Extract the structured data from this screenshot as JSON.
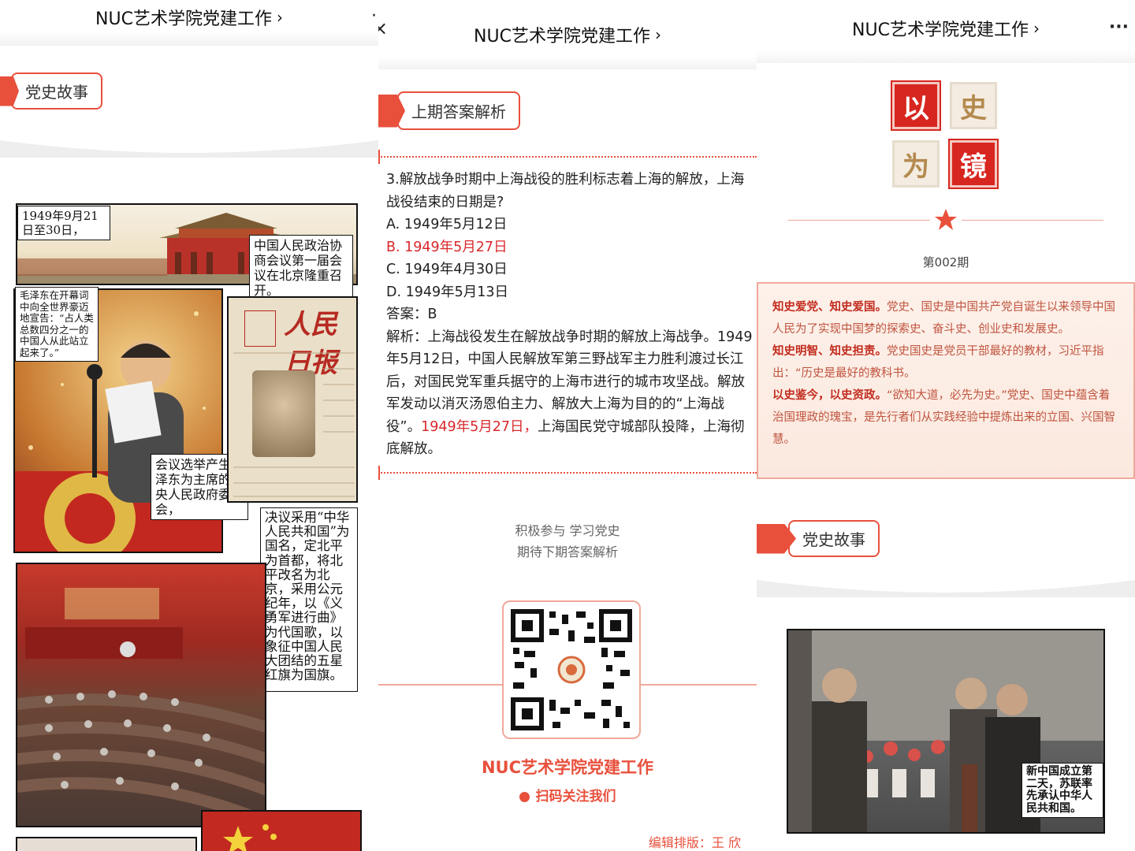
{
  "p1": {
    "title": "NUC艺术学院党建工作",
    "dots_icon": "·",
    "section_tag": "党史故事",
    "comic": {
      "box1": "1949年9月21日至30日，",
      "box2": "中国人民政治协商会议第一届会议在北京隆重召开。",
      "box3": "毛泽东在开幕词中向全世界豪迈地宣告：“占人类总数四分之一的中国人从此站立起来了。”",
      "newspaper": "人民日报",
      "box4": "会议选举产生毛泽东为主席的中央人民政府委员会，",
      "box5": "决议采用“中华人民共和国”为国名，定北平为首都，将北平改名为北京，采用公元纪年，以《义勇军进行曲》为代国歌，以象征中国人民大团结的五星红旗为国旗。"
    }
  },
  "p2": {
    "title": "NUC艺术学院党建工作",
    "close_icon": "×",
    "section_tag": "上期答案解析",
    "question": "3.解放战争时期中上海战役的胜利标志着上海的解放，上海战役结束的日期是?",
    "options": [
      "A. 1949年5月12日",
      "B. 1949年5月27日",
      "C. 1949年4月30日",
      "D. 1949年5月13日"
    ],
    "answer": "答案：B",
    "analysis_a": "解析：上海战役发生在解放战争时期的解放上海战争。1949年5月12日，中国人民解放军第三野战军主力胜利渡过长江后，对国民党军重兵据守的上海市进行的城市攻坚战。解放军发动以消灭汤恩伯主力、解放大上海为目的的“上海战役”。",
    "analysis_red": "1949年5月27日，",
    "analysis_b": "上海国民党守城部队投降，上海彻底解放。",
    "cta1": "积极参与 学习党史",
    "cta2": "期待下期答案解析",
    "brand": "NUC艺术学院党建工作",
    "scan": "扫码关注我们",
    "editor": "编辑排版：王 欣"
  },
  "p3": {
    "title": "NUC艺术学院党建工作",
    "more_icon": "···",
    "seal_chars": [
      "以",
      "史",
      "为",
      "镜"
    ],
    "issue": "第002期",
    "intro": {
      "h1": "知史爱党、知史爱国。",
      "t1": "党史、国史是中国共产党自诞生以来领导中国人民为了实现中国梦的探索史、奋斗史、创业史和发展史。",
      "h2": "知史明智、知史担责。",
      "t2": "党史国史是党员干部最好的教材，习近平指出：“历史是最好的教科书。",
      "h3": "以史鉴今，以史资政。",
      "t3": "“欲知大道，必先为史。”党史、国史中蕴含着治国理政的瑰宝，是先行者们从实践经验中提炼出来的立国、兴国智慧。"
    },
    "section_tag": "党史故事",
    "comic_caption": "新中国成立第二天，苏联率先承认中华人民共和国。"
  },
  "colors": {
    "accent": "#e8503c",
    "red_text": "#d8282c"
  }
}
